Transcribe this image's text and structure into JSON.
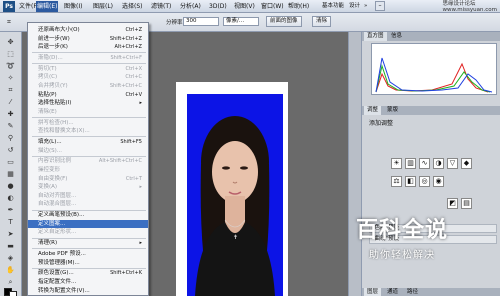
{
  "app": {
    "logo": "Ps",
    "site_mark": "思缘设计论坛\nwww.missyuan.com"
  },
  "menubar": {
    "items": [
      "文件(F)",
      "编辑(E)",
      "图像(I)",
      "图层(L)",
      "选择(S)",
      "滤镜(T)",
      "分析(A)",
      "3D(D)",
      "视图(V)",
      "窗口(W)",
      "帮助(H)"
    ],
    "zoom": "100%",
    "workspace": "基本功能",
    "design": "设计",
    "more": "»"
  },
  "options": {
    "resolution_label": "分辨率:",
    "resolution_value": "300",
    "resolution_unit": "像素/...",
    "front_image_btn": "前面的图像",
    "clear_btn": "清除"
  },
  "edit_menu": {
    "items": [
      {
        "label": "还原画布大小(O)",
        "shortcut": "Ctrl+Z",
        "disabled": false
      },
      {
        "label": "前进一步(W)",
        "shortcut": "Shift+Ctrl+Z",
        "disabled": false
      },
      {
        "label": "后退一步(K)",
        "shortcut": "Alt+Ctrl+Z",
        "disabled": false
      },
      {
        "label": "渐隐(D)...",
        "shortcut": "Shift+Ctrl+F",
        "disabled": true
      },
      {
        "label": "剪切(T)",
        "shortcut": "Ctrl+X",
        "disabled": true
      },
      {
        "label": "拷贝(C)",
        "shortcut": "Ctrl+C",
        "disabled": true
      },
      {
        "label": "合并拷贝(Y)",
        "shortcut": "Shift+Ctrl+C",
        "disabled": true
      },
      {
        "label": "粘贴(P)",
        "shortcut": "Ctrl+V",
        "disabled": false
      },
      {
        "label": "选择性粘贴(I)",
        "shortcut": "▸",
        "disabled": false
      },
      {
        "label": "清除(E)",
        "shortcut": "",
        "disabled": true
      },
      {
        "label": "拼写检查(H)...",
        "shortcut": "",
        "disabled": true
      },
      {
        "label": "查找和替换文本(X)...",
        "shortcut": "",
        "disabled": true
      },
      {
        "label": "填充(L)...",
        "shortcut": "Shift+F5",
        "disabled": false
      },
      {
        "label": "描边(S)...",
        "shortcut": "",
        "disabled": true
      },
      {
        "label": "内容识别比例",
        "shortcut": "Alt+Shift+Ctrl+C",
        "disabled": true
      },
      {
        "label": "操控变形",
        "shortcut": "",
        "disabled": true
      },
      {
        "label": "自由变换(F)",
        "shortcut": "Ctrl+T",
        "disabled": true
      },
      {
        "label": "变换(A)",
        "shortcut": "▸",
        "disabled": true
      },
      {
        "label": "自动对齐图层...",
        "shortcut": "",
        "disabled": true
      },
      {
        "label": "自动混合图层...",
        "shortcut": "",
        "disabled": true
      },
      {
        "label": "定义画笔预设(B)...",
        "shortcut": "",
        "disabled": false
      },
      {
        "label": "定义图案...",
        "shortcut": "",
        "highlighted": true,
        "disabled": false
      },
      {
        "label": "定义自定形状...",
        "shortcut": "",
        "disabled": true
      },
      {
        "label": "清理(R)",
        "shortcut": "▸",
        "disabled": false
      },
      {
        "label": "Adobe PDF 预设...",
        "shortcut": "",
        "disabled": false
      },
      {
        "label": "预设管理器(M)...",
        "shortcut": "",
        "disabled": false
      },
      {
        "label": "颜色设置(G)...",
        "shortcut": "Shift+Ctrl+K",
        "disabled": false
      },
      {
        "label": "指定配置文件...",
        "shortcut": "",
        "disabled": false
      },
      {
        "label": "转换为配置文件(V)...",
        "shortcut": "",
        "disabled": false
      }
    ]
  },
  "panels": {
    "tab_histogram": "直方图",
    "tab_info": "信息",
    "tab_adjust": "调整",
    "tab_mask": "蒙版",
    "adjust_title": "添加调整",
    "preset_1": "\"色阶\"预设",
    "preset_2": "\"曲线\"预设",
    "layers_tabs": [
      "图层",
      "通道",
      "路径"
    ]
  },
  "watermark": {
    "title": "百科全说",
    "subtitle": "助你轻松解决"
  },
  "colors": {
    "canvas_blue": "#0c14e6",
    "highlight": "#3b6fc2"
  }
}
